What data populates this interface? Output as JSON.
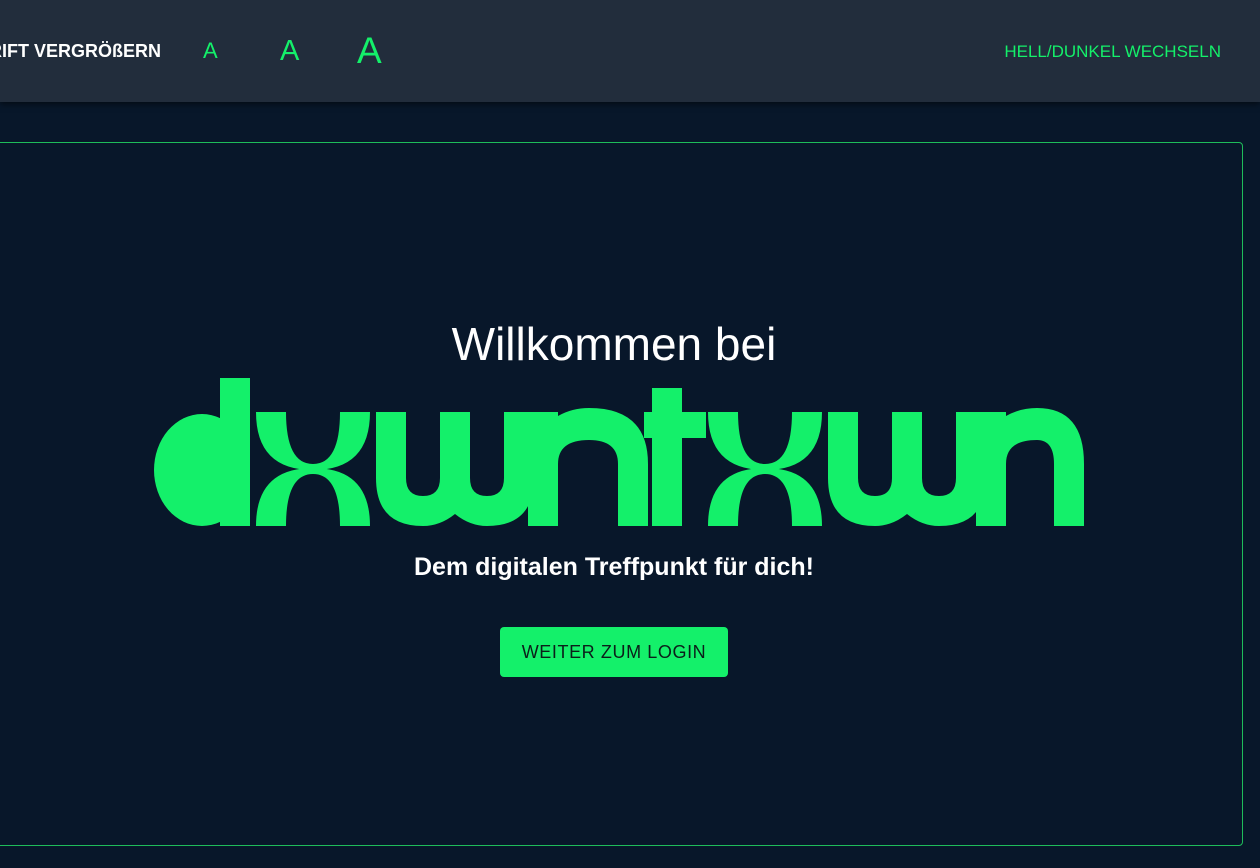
{
  "header": {
    "font_size_label": "SCHRIFT VERGRÖßERN",
    "font_size_small": "A",
    "font_size_medium": "A",
    "font_size_large": "A",
    "theme_toggle_label": "HELL/DUNKEL WECHSELN"
  },
  "main": {
    "welcome_text": "Willkommen bei",
    "logo_text": "downtown",
    "subtitle": "Dem digitalen Treffpunkt für dich!",
    "login_button": "WEITER ZUM LOGIN"
  },
  "colors": {
    "accent": "#14f06a",
    "background": "#08172a",
    "header_background": "#222d3c",
    "card_border": "#1ebc5a"
  }
}
